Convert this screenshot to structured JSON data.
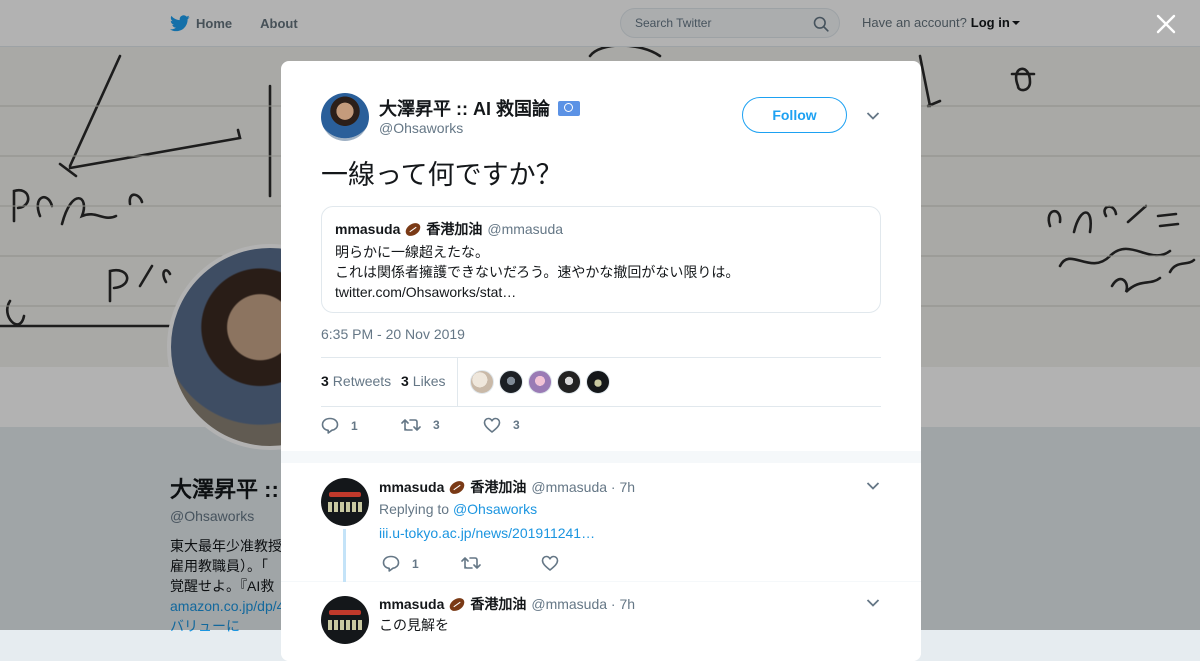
{
  "nav": {
    "home": "Home",
    "about": "About",
    "search_placeholder": "Search Twitter",
    "have_account": "Have an account?",
    "login": "Log in"
  },
  "profile": {
    "name": "大澤昇平 :: ",
    "handle": "@Ohsaworks",
    "bio_lines": [
      "東大最年少准教授",
      "雇用教職員）。「",
      "覚醒せよ。『AI救"
    ],
    "link_text": "amazon.co.jp/dp/4",
    "bio_tail": "バリューに"
  },
  "tweet": {
    "author_name": "大澤昇平 :: AI 救国論",
    "author_handle": "@Ohsaworks",
    "follow_label": "Follow",
    "text": "一線って何ですか？",
    "quote": {
      "name": "mmasuda",
      "name_suffix": "香港加油",
      "handle": "@mmasuda",
      "line1": "明らかに一線超えたな。",
      "line2": "これは関係者擁護できないだろう。速やかな撤回がない限りは。",
      "line3": "twitter.com/Ohsaworks/stat…"
    },
    "timestamp": "6:35 PM - 20 Nov 2019",
    "retweets_count": "3",
    "retweets_label": "Retweets",
    "likes_count": "3",
    "likes_label": "Likes",
    "action_counts": {
      "reply": "1",
      "retweet": "3",
      "like": "3"
    }
  },
  "replies": [
    {
      "name": "mmasuda",
      "name_suffix": "香港加油",
      "meta": "@mmasuda · 7h",
      "replying_prefix": "Replying to",
      "replying_to": "@Ohsaworks",
      "link": "iii.u-tokyo.ac.jp/news/201911241…",
      "reply_count": "1"
    },
    {
      "name": "mmasuda",
      "name_suffix": "香港加油",
      "meta": "@mmasuda · 7h",
      "text": "この見解を"
    }
  ],
  "icons": {
    "twitter": "twitter-bird-icon",
    "search": "magnifier-icon",
    "close": "x-icon",
    "reply": "speech-bubble-icon",
    "retweet": "retweet-arrows-icon",
    "like": "heart-icon",
    "chevron": "chevron-down-icon",
    "badge": "un-flag-icon",
    "football": "american-football-emoji"
  },
  "colors": {
    "brand": "#1da1f2",
    "link": "#1b95e0",
    "text": "#14171a",
    "muted": "#657786",
    "border": "#e1e8ed"
  }
}
